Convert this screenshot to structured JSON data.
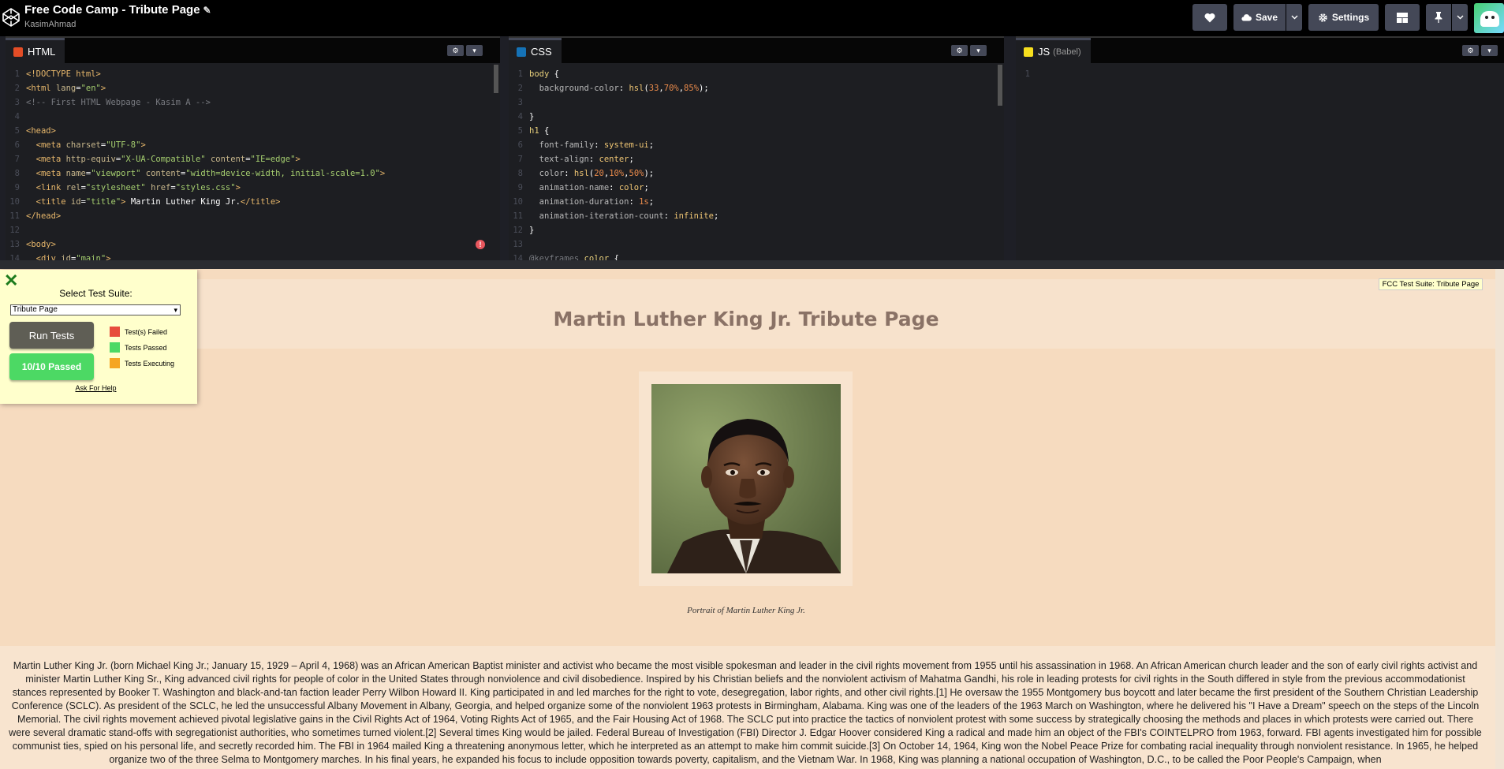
{
  "header": {
    "title": "Free Code Camp - Tribute Page",
    "author": "KasimAhmad",
    "heart_icon": "heart-icon",
    "save_label": "Save",
    "settings_label": "Settings"
  },
  "editors": {
    "html": {
      "tab_label": "HTML",
      "lines": [
        {
          "n": "1",
          "html": "<span class=\"tok-tag\">&lt;!DOCTYPE html&gt;</span>"
        },
        {
          "n": "2",
          "html": "<span class=\"tok-tag\">&lt;html</span> <span class=\"tok-attr\">lang</span>=<span class=\"tok-str\">\"en\"</span><span class=\"tok-tag\">&gt;</span>"
        },
        {
          "n": "3",
          "html": "<span class=\"tok-com\">&lt;!-- First HTML Webpage - Kasim A --&gt;</span>"
        },
        {
          "n": "4",
          "html": ""
        },
        {
          "n": "5",
          "html": "<span class=\"tok-tag\">&lt;head&gt;</span>"
        },
        {
          "n": "6",
          "html": "  <span class=\"tok-tag\">&lt;meta</span> <span class=\"tok-attr\">charset</span>=<span class=\"tok-str\">\"UTF-8\"</span><span class=\"tok-tag\">&gt;</span>"
        },
        {
          "n": "7",
          "html": "  <span class=\"tok-tag\">&lt;meta</span> <span class=\"tok-attr\">http-equiv</span>=<span class=\"tok-str\">\"X-UA-Compatible\"</span> <span class=\"tok-attr\">content</span>=<span class=\"tok-str\">\"IE=edge\"</span><span class=\"tok-tag\">&gt;</span>"
        },
        {
          "n": "8",
          "html": "  <span class=\"tok-tag\">&lt;meta</span> <span class=\"tok-attr\">name</span>=<span class=\"tok-str\">\"viewport\"</span> <span class=\"tok-attr\">content</span>=<span class=\"tok-str\">\"width=device-width, initial-scale=1.0\"</span><span class=\"tok-tag\">&gt;</span>"
        },
        {
          "n": "9",
          "html": "  <span class=\"tok-tag\">&lt;link</span> <span class=\"tok-attr\">rel</span>=<span class=\"tok-str\">\"stylesheet\"</span> <span class=\"tok-attr\">href</span>=<span class=\"tok-str\">\"styles.css\"</span><span class=\"tok-tag\">&gt;</span>"
        },
        {
          "n": "10",
          "html": "  <span class=\"tok-tag\">&lt;title</span> <span class=\"tok-attr\">id</span>=<span class=\"tok-str\">\"title\"</span><span class=\"tok-tag\">&gt;</span> Martin Luther King Jr.<span class=\"tok-tag\">&lt;/title&gt;</span>"
        },
        {
          "n": "11",
          "html": "<span class=\"tok-tag\">&lt;/head&gt;</span>"
        },
        {
          "n": "12",
          "html": ""
        },
        {
          "n": "13",
          "html": "<span class=\"tok-tag\">&lt;body&gt;</span>"
        },
        {
          "n": "14",
          "html": "  <span class=\"tok-tag\">&lt;div</span> <span class=\"tok-attr\">id</span>=<span class=\"tok-str\">\"main\"</span><span class=\"tok-tag\">&gt;</span>"
        }
      ]
    },
    "css": {
      "tab_label": "CSS",
      "lines": [
        {
          "n": "1",
          "html": "<span class=\"tok-sel\">body</span> {"
        },
        {
          "n": "2",
          "html": "  <span class=\"tok-prop\">background-color</span>: <span class=\"tok-val\">hsl</span>(<span class=\"tok-num\">33</span>,<span class=\"tok-num\">70%</span>,<span class=\"tok-num\">85%</span>);"
        },
        {
          "n": "3",
          "html": ""
        },
        {
          "n": "4",
          "html": "}"
        },
        {
          "n": "5",
          "html": "<span class=\"tok-sel\">h1</span> {"
        },
        {
          "n": "6",
          "html": "  <span class=\"tok-prop\">font-family</span>: <span class=\"tok-val\">system-ui</span>;"
        },
        {
          "n": "7",
          "html": "  <span class=\"tok-prop\">text-align</span>: <span class=\"tok-val\">center</span>;"
        },
        {
          "n": "8",
          "html": "  <span class=\"tok-prop\">color</span>: <span class=\"tok-val\">hsl</span>(<span class=\"tok-num\">20</span>,<span class=\"tok-num\">10%</span>,<span class=\"tok-num\">50%</span>);"
        },
        {
          "n": "9",
          "html": "  <span class=\"tok-prop\">animation-name</span>: <span class=\"tok-val\">color</span>;"
        },
        {
          "n": "10",
          "html": "  <span class=\"tok-prop\">animation-duration</span>: <span class=\"tok-num\">1s</span>;"
        },
        {
          "n": "11",
          "html": "  <span class=\"tok-prop\">animation-iteration-count</span>: <span class=\"tok-val\">infinite</span>;"
        },
        {
          "n": "12",
          "html": "}"
        },
        {
          "n": "13",
          "html": ""
        },
        {
          "n": "14",
          "html": "<span class=\"tok-com\">@keyframes</span> <span class=\"tok-sel\">color</span> {"
        }
      ]
    },
    "js": {
      "tab_label": "JS",
      "tab_sub": "(Babel)",
      "lines": [
        {
          "n": "1",
          "html": ""
        }
      ]
    }
  },
  "preview": {
    "h1": "Martin Luther King Jr. Tribute Page",
    "img_caption": "Portrait of Martin Luther King Jr.",
    "bio": "Martin Luther King Jr. (born Michael King Jr.; January 15, 1929 – April 4, 1968) was an African American Baptist minister and activist who became the most visible spokesman and leader in the civil rights movement from 1955 until his assassination in 1968. An African American church leader and the son of early civil rights activist and minister Martin Luther King Sr., King advanced civil rights for people of color in the United States through nonviolence and civil disobedience. Inspired by his Christian beliefs and the nonviolent activism of Mahatma Gandhi, his role in leading protests for civil rights in the South differed in style from the previous accommodationist stances represented by Booker T. Washington and black-and-tan faction leader Perry Wilbon Howard II. King participated in and led marches for the right to vote, desegregation, labor rights, and other civil rights.[1] He oversaw the 1955 Montgomery bus boycott and later became the first president of the Southern Christian Leadership Conference (SCLC). As president of the SCLC, he led the unsuccessful Albany Movement in Albany, Georgia, and helped organize some of the nonviolent 1963 protests in Birmingham, Alabama. King was one of the leaders of the 1963 March on Washington, where he delivered his \"I Have a Dream\" speech on the steps of the Lincoln Memorial. The civil rights movement achieved pivotal legislative gains in the Civil Rights Act of 1964, Voting Rights Act of 1965, and the Fair Housing Act of 1968. The SCLC put into practice the tactics of nonviolent protest with some success by strategically choosing the methods and places in which protests were carried out. There were several dramatic stand-offs with segregationist authorities, who sometimes turned violent.[2] Several times King would be jailed. Federal Bureau of Investigation (FBI) Director J. Edgar Hoover considered King a radical and made him an object of the FBI's COINTELPRO from 1963, forward. FBI agents investigated him for possible communist ties, spied on his personal life, and secretly recorded him. The FBI in 1964 mailed King a threatening anonymous letter, which he interpreted as an attempt to make him commit suicide.[3] On October 14, 1964, King won the Nobel Peace Prize for combating racial inequality through nonviolent resistance. In 1965, he helped organize two of the three Selma to Montgomery marches. In his final years, he expanded his focus to include opposition towards poverty, capitalism, and the Vietnam War. In 1968, King was planning a national occupation of Washington, D.C., to be called the Poor People's Campaign, when"
  },
  "fcc": {
    "select_label": "Select Test Suite:",
    "select_value": "Tribute Page",
    "run_label": "Run Tests",
    "passed_label": "10/10 Passed",
    "legend": [
      {
        "label": "Test(s) Failed",
        "color": "#e74c3c"
      },
      {
        "label": "Tests Passed",
        "color": "#4cd964"
      },
      {
        "label": "Tests Executing",
        "color": "#f5a623"
      }
    ],
    "help_label": "Ask For Help",
    "badge_label": "FCC Test Suite: Tribute Page"
  },
  "colors": {
    "html_badge": "#e44d26",
    "css_badge": "#1572b6",
    "js_badge": "#f7df1e"
  }
}
